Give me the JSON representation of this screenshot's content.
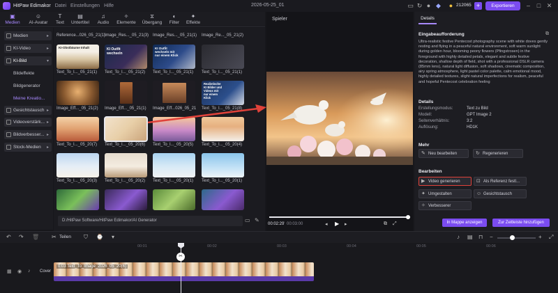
{
  "app": {
    "name": "HitPaw Edimakor",
    "menus": [
      "Datei",
      "Einstellungen",
      "Hilfe"
    ],
    "title": "2026-05-25_01",
    "credits": "212065",
    "export_label": "Exportieren"
  },
  "toolbar": {
    "items": [
      "Medien",
      "AI-Avatar",
      "Text",
      "Untertitel",
      "Audio",
      "Elemente",
      "Übergang",
      "Filter",
      "Effekte"
    ]
  },
  "sidebar": {
    "groups": [
      "Medien",
      "KI-Video",
      "KI-Bild",
      "Gesichtstausch",
      "Videoverstärk...",
      "Bildverbesser...",
      "Stock-Medien"
    ],
    "sub_items": [
      "Bildeffekte",
      "Bildgenerator",
      "Meine Kreatio..."
    ]
  },
  "media": {
    "captions": [
      "Reference...026_05_21(1)",
      "Image_Res..._05_21(3)",
      "Image_Res..._05_21(1)",
      "Image_Re..._05_21(2)",
      "Text_To_I..._05_21(1)",
      "Text_To_I..._05_21(2)",
      "Text_To_I..._05_21(1)",
      "Text_To_I..._05_21(1)",
      "Image_Eff..._05_21(2)",
      "Image_Eff..._05_21(1)",
      "Image_Eff...026_05_21",
      "Text_To_I..._05_21(8)",
      "Text_To_I..._05_20(7)",
      "Text_To_I..._05_20(6)",
      "Text_To_I..._05_20(5)",
      "Text_To_I..._05_20(4)",
      "Text_To_I..._05_20(3)",
      "Text_To_I..._05_20(2)",
      "Text_To_I..._05_20(1)",
      "Text_To_I..._05_20(1)"
    ],
    "thumb_texts": [
      "KI-Obstbäume Inhalt",
      "KI Outfit wechseln",
      "KI Outfit wechseln mit nur einem Klick",
      "Realistische KI Bilder und Videos mit nur einem Klick"
    ],
    "path": "D:/HitPaw Software/HitPaw Edimakor/AI Generator"
  },
  "player": {
    "label": "Spieler",
    "time_current": "00:02:29",
    "time_total": "00:03:00"
  },
  "details": {
    "tab": "Details",
    "prompt_heading": "Eingabeaufforderung",
    "prompt": "Ultra-realistic festive Pentecost photography scene with white doves gently resting and flying in a peaceful natural environment, soft warm sunlight during golden hour, blooming peony flowers (Pfingstrosen) in the foreground with highly detailed petals, elegant and subtle festive decoration, shallow depth of field, shot with a professional DSLR camera (85mm lens), natural light diffusion, soft shadows, cinematic composition, airy spring atmosphere, light pastel color palette, calm emotional mood, highly detailed textures, slight natural imperfections for realism, peaceful and hopeful Pentecost celebration feeling",
    "details_heading": "Details",
    "fields": [
      {
        "k": "Erstellungsmodus:",
        "v": "Text zu Bild"
      },
      {
        "k": "Modell:",
        "v": "GPT Image 2"
      },
      {
        "k": "Seitenverhältnis:",
        "v": "3:2"
      },
      {
        "k": "Auflösung:",
        "v": "HD1K"
      }
    ],
    "more_heading": "Mehr",
    "more_buttons": [
      "Neu bearbeiten",
      "Regenerieren"
    ],
    "edit_heading": "Bearbeiten",
    "edit_buttons": [
      "Video generieren",
      "Als Referenz festl...",
      "Umgestalten",
      "Gesichtstausch",
      "Verbesserer"
    ],
    "bottom_buttons": [
      "In Mappe anzeigen",
      "Zur Zeitleiste hinzufügen"
    ]
  },
  "timeline": {
    "split_label": "Teilen",
    "cover_label": "Cover",
    "clip_label": "0:03  Text_To_Image_2026_05_20(6)",
    "ruler": [
      "00:01",
      "00:02",
      "00:03",
      "00:04",
      "00:05",
      "00:06"
    ]
  },
  "colors": {
    "accent": "#7b4cf0",
    "highlight": "#e0423a"
  }
}
